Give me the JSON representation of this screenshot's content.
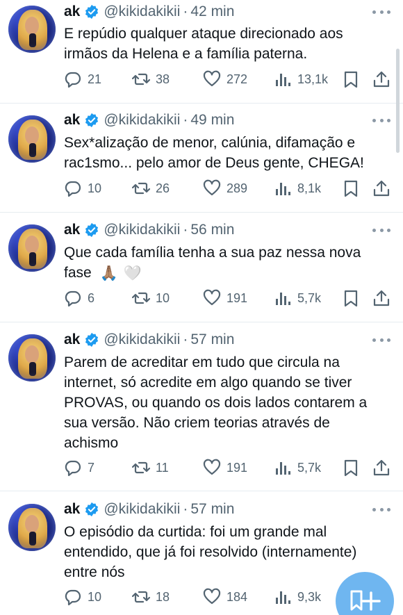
{
  "colors": {
    "accent": "#1d9bf0",
    "muted": "#536471",
    "text": "#0f1419",
    "fab": "#6fb6f0"
  },
  "icons": {
    "reply": "reply-icon",
    "retweet": "retweet-icon",
    "like": "heart-icon",
    "views": "views-icon",
    "bookmark": "bookmark-icon",
    "share": "share-icon",
    "more": "more-icon",
    "verified": "verified-badge-icon",
    "compose": "compose-icon"
  },
  "tweets": [
    {
      "name": "ak",
      "handle": "@kikidakikii",
      "time": "42 min",
      "text_lines": [
        "E repúdio qualquer ataque direcionado aos",
        "irmãos da Helena e a família paterna."
      ],
      "replies": "21",
      "retweets": "38",
      "likes": "272",
      "views": "13,1k"
    },
    {
      "name": "ak",
      "handle": "@kikidakikii",
      "time": "49 min",
      "text_lines": [
        "Sex*alização de menor, calúnia, difamação e",
        "rac1smo... pelo amor de Deus gente, CHEGA!"
      ],
      "replies": "10",
      "retweets": "26",
      "likes": "289",
      "views": "8,1k"
    },
    {
      "name": "ak",
      "handle": "@kikidakikii",
      "time": "56 min",
      "text_lines": [
        "Que cada família tenha a sua paz nessa nova",
        "fase"
      ],
      "emojis": [
        "🙏🏽",
        "🤍"
      ],
      "replies": "6",
      "retweets": "10",
      "likes": "191",
      "views": "5,7k"
    },
    {
      "name": "ak",
      "handle": "@kikidakikii",
      "time": "57 min",
      "text_lines": [
        "Parem de acreditar em tudo que circula na",
        "internet, só acredite em algo quando se tiver",
        "PROVAS, ou quando os dois lados contarem a",
        "sua versão. Não criem teorias através de",
        "achismo"
      ],
      "replies": "7",
      "retweets": "11",
      "likes": "191",
      "views": "5,7k"
    },
    {
      "name": "ak",
      "handle": "@kikidakikii",
      "time": "57 min",
      "text_lines": [
        "O episódio da curtida: foi um grande mal",
        "entendido, que já foi resolvido (internamente)",
        "entre nós"
      ],
      "replies": "10",
      "retweets": "18",
      "likes": "184",
      "views": "9,3k"
    }
  ]
}
